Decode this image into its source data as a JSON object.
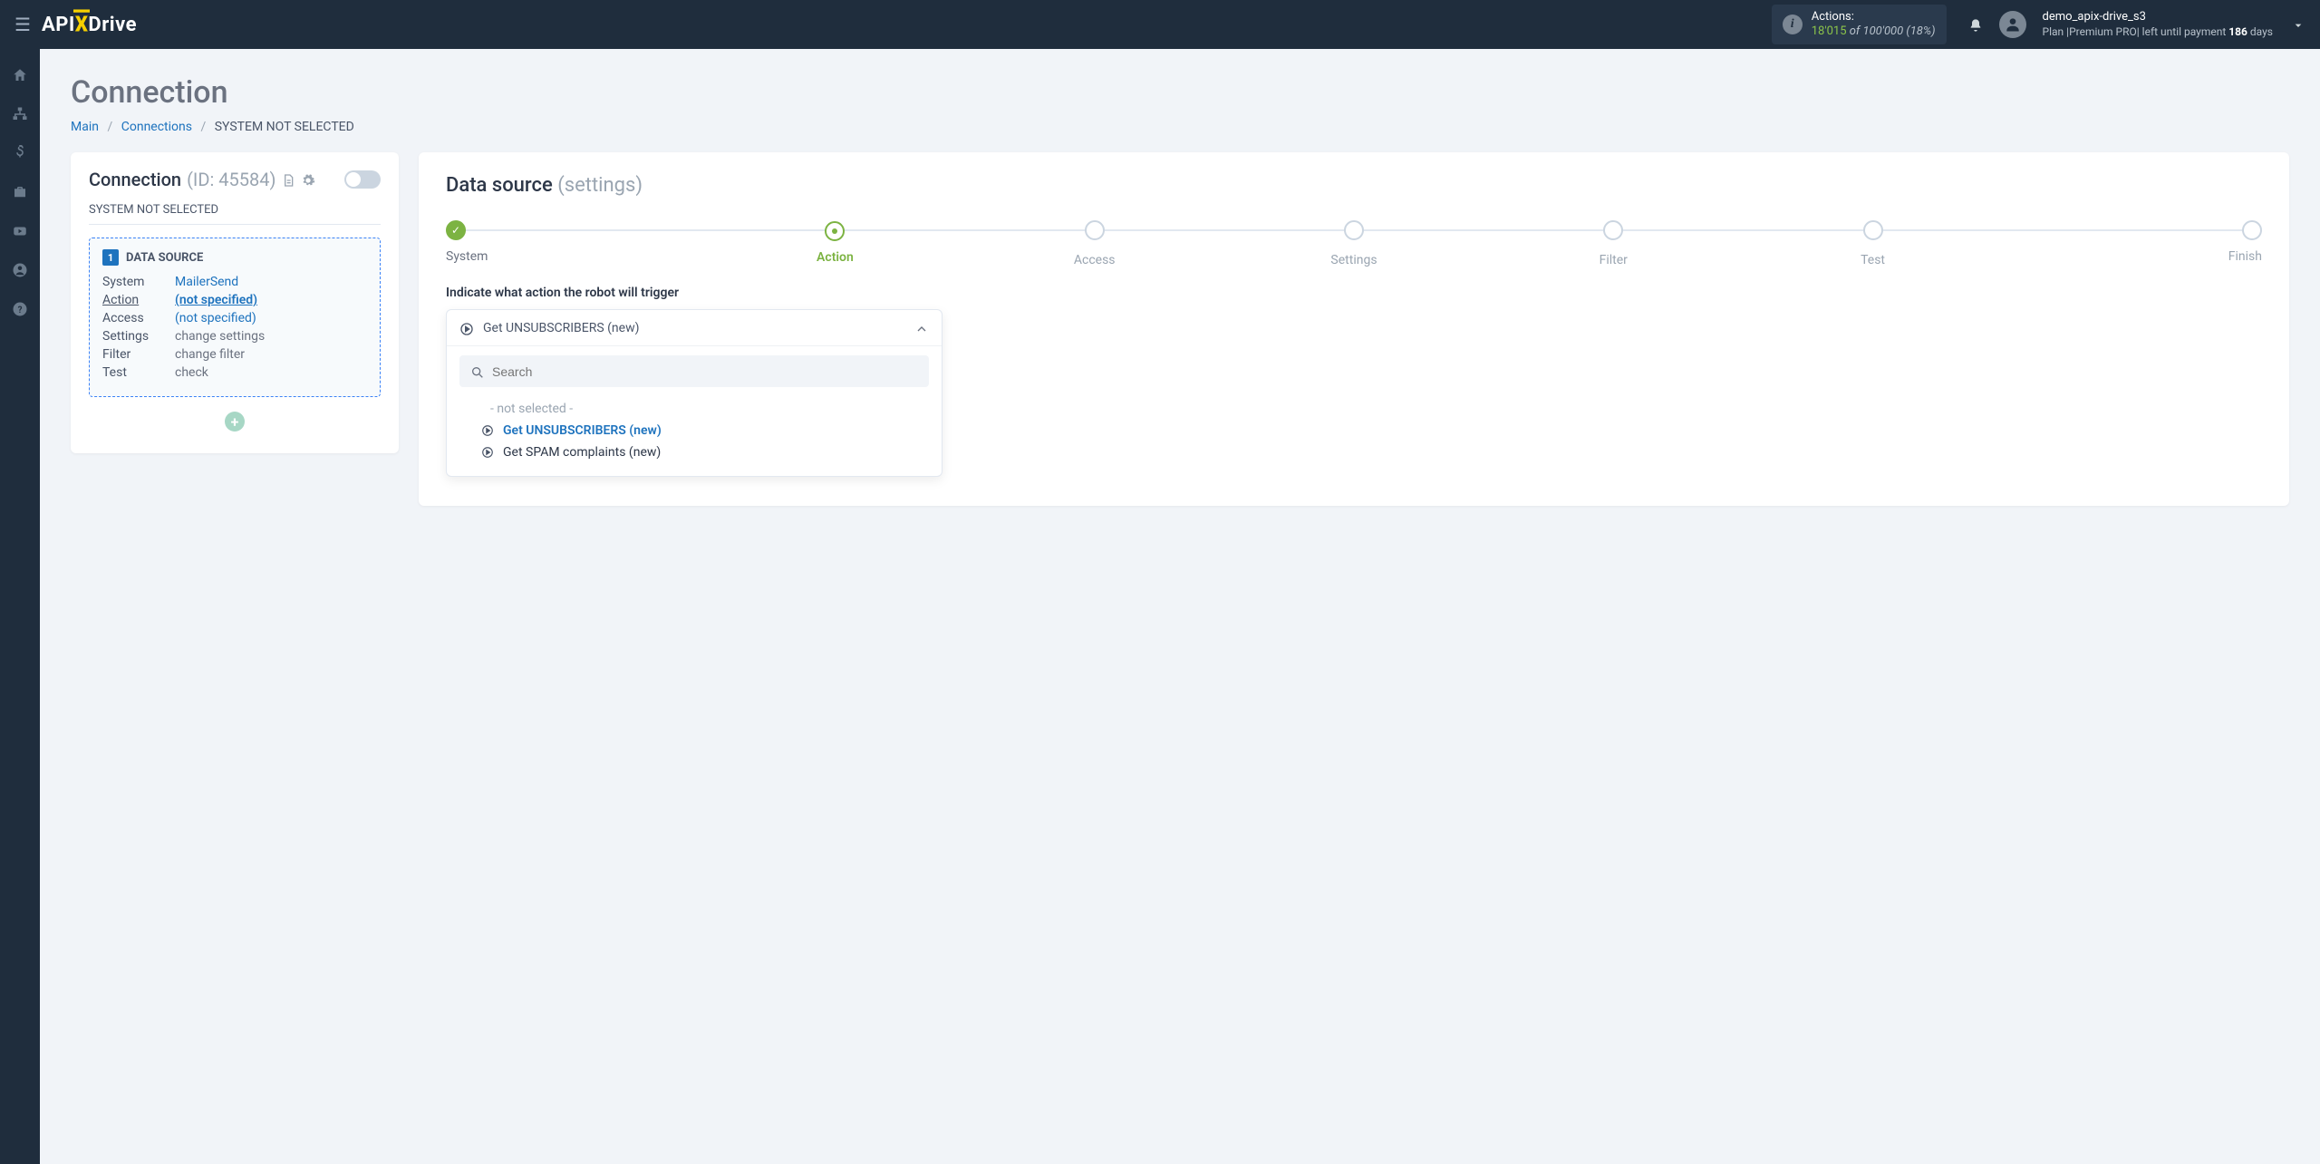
{
  "header": {
    "logo_pre": "API",
    "logo_x": "X",
    "logo_post": "Drive",
    "actions_label": "Actions:",
    "actions_used": "18'015",
    "actions_of": " of ",
    "actions_total": "100'000",
    "actions_percent": " (18%)",
    "user_name": "demo_apix-drive_s3",
    "plan_pre": "Plan |",
    "plan_name": "Premium PRO",
    "plan_mid": "| left until payment ",
    "plan_days": "186",
    "plan_suffix": " days"
  },
  "page": {
    "title": "Connection",
    "breadcrumb_main": "Main",
    "breadcrumb_connections": "Connections",
    "breadcrumb_current": "SYSTEM NOT SELECTED"
  },
  "conn_card": {
    "title": "Connection",
    "id_label": "(ID: 45584)",
    "subtitle": "SYSTEM NOT SELECTED",
    "ds_num": "1",
    "ds_title": "DATA SOURCE",
    "rows": {
      "system_k": "System",
      "system_v": "MailerSend",
      "action_k": "Action",
      "action_v": "(not specified)",
      "access_k": "Access",
      "access_v": "(not specified)",
      "settings_k": "Settings",
      "settings_v": "change settings",
      "filter_k": "Filter",
      "filter_v": "change filter",
      "test_k": "Test",
      "test_v": "check"
    }
  },
  "main_card": {
    "title": "Data source",
    "title_muted": "(settings)",
    "steps": [
      "System",
      "Action",
      "Access",
      "Settings",
      "Filter",
      "Test",
      "Finish"
    ],
    "prompt": "Indicate what action the robot will trigger",
    "selected": "Get UNSUBSCRIBERS (new)",
    "search_placeholder": "Search",
    "options": {
      "none": "- not selected -",
      "opt1": "Get UNSUBSCRIBERS (new)",
      "opt2": "Get SPAM complaints (new)"
    }
  }
}
